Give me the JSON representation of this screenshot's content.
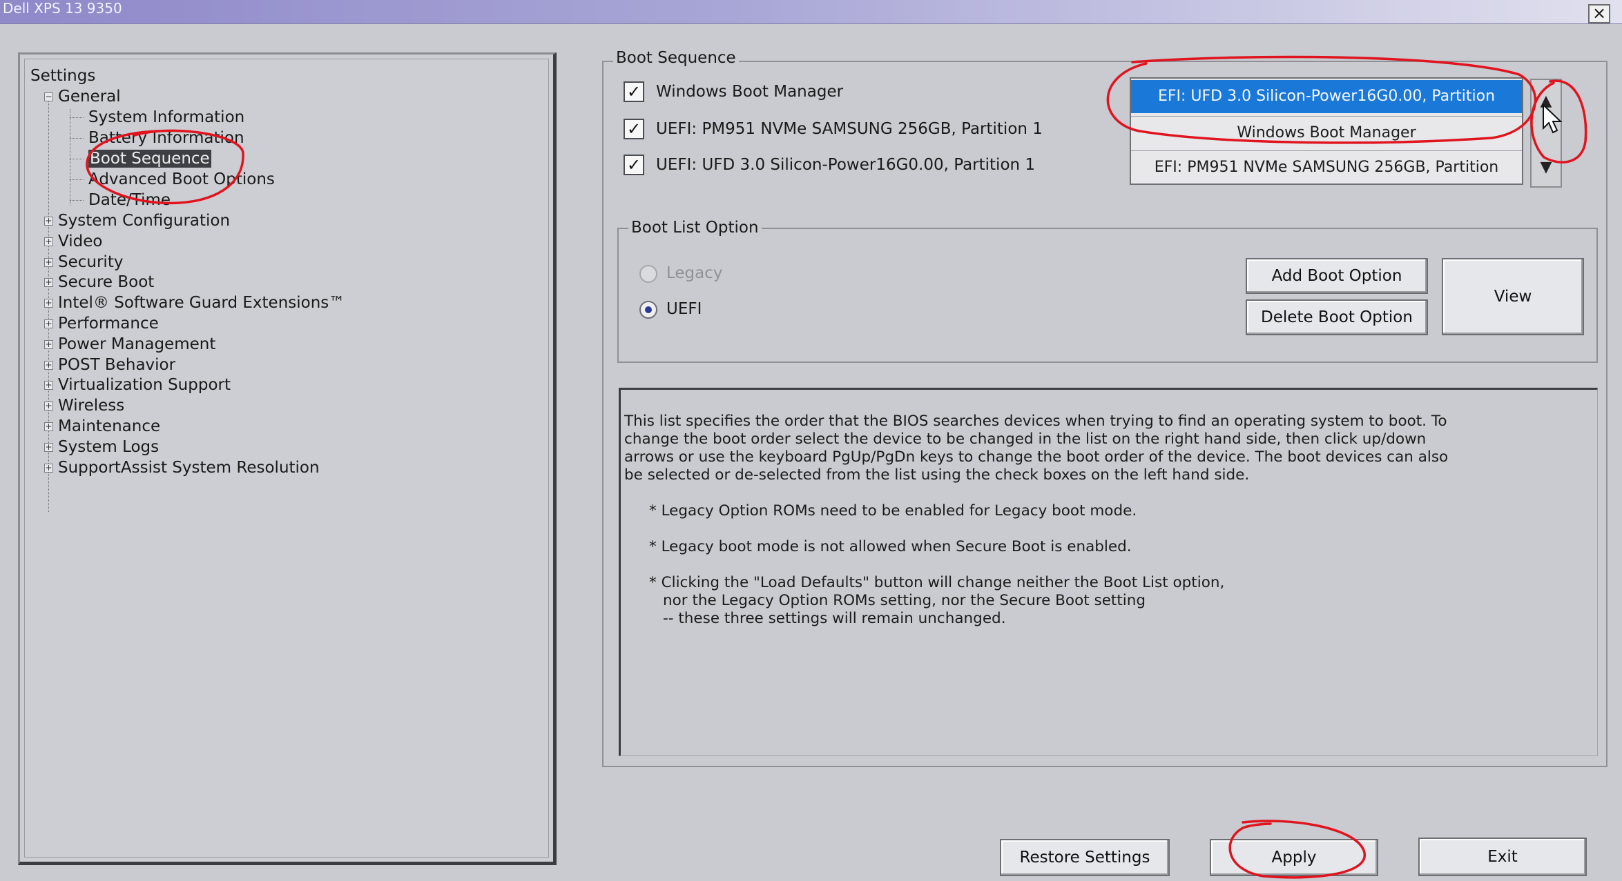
{
  "window": {
    "title": "Dell XPS 13 9350",
    "close_label": "×"
  },
  "tree": {
    "root": "Settings",
    "general": "General",
    "general_children": [
      "System Information",
      "Battery Information",
      "Boot Sequence",
      "Advanced Boot Options",
      "Date/Time"
    ],
    "sections": [
      "System Configuration",
      "Video",
      "Security",
      "Secure Boot",
      "Intel® Software Guard Extensions™",
      "Performance",
      "Power Management",
      "POST Behavior",
      "Virtualization Support",
      "Wireless",
      "Maintenance",
      "System Logs",
      "SupportAssist System Resolution"
    ],
    "expand_symbol": "+",
    "collapse_symbol": "−"
  },
  "boot_sequence": {
    "title": "Boot Sequence",
    "devices": [
      {
        "label": "Windows Boot Manager",
        "checked": "✓"
      },
      {
        "label": "UEFI: PM951 NVMe SAMSUNG 256GB, Partition 1",
        "checked": "✓"
      },
      {
        "label": "UEFI: UFD 3.0 Silicon-Power16G0.00, Partition 1",
        "checked": "✓"
      }
    ],
    "order_list": [
      "EFI: UFD 3.0 Silicon-Power16G0.00, Partition",
      "Windows Boot Manager",
      "EFI: PM951 NVMe SAMSUNG 256GB, Partition"
    ],
    "scroll_up": "▲",
    "scroll_down": "▼"
  },
  "boot_list_option": {
    "title": "Boot List Option",
    "legacy_label": "Legacy",
    "uefi_label": "UEFI",
    "add_button": "Add Boot Option",
    "delete_button": "Delete Boot Option",
    "view_button": "View"
  },
  "description": {
    "lines": [
      "This list specifies the order that the BIOS searches devices when trying to find an operating system to boot. To",
      "change the boot order select the device to be changed in the list on the right hand side, then click up/down",
      "arrows or use the keyboard PgUp/PgDn keys to change the boot order of the device. The boot devices can also",
      "be selected or de-selected from the list using the check boxes on the left hand side."
    ],
    "note1": "* Legacy Option ROMs need to be enabled for Legacy boot mode.",
    "note2": "* Legacy boot mode is not allowed when Secure Boot is enabled.",
    "note3_lines": [
      "* Clicking the \"Load Defaults\" button will change neither the Boot List option,",
      "nor the Legacy Option ROMs setting, nor the Secure Boot setting",
      "-- these three settings will remain unchanged."
    ]
  },
  "footer": {
    "restore": "Restore Settings",
    "apply": "Apply",
    "exit": "Exit"
  },
  "colors": {
    "background": "#c9cbd0",
    "selection_blue": "#1a78d8",
    "annotation_red": "#e0141e",
    "titlebar": "#8f89c9"
  }
}
